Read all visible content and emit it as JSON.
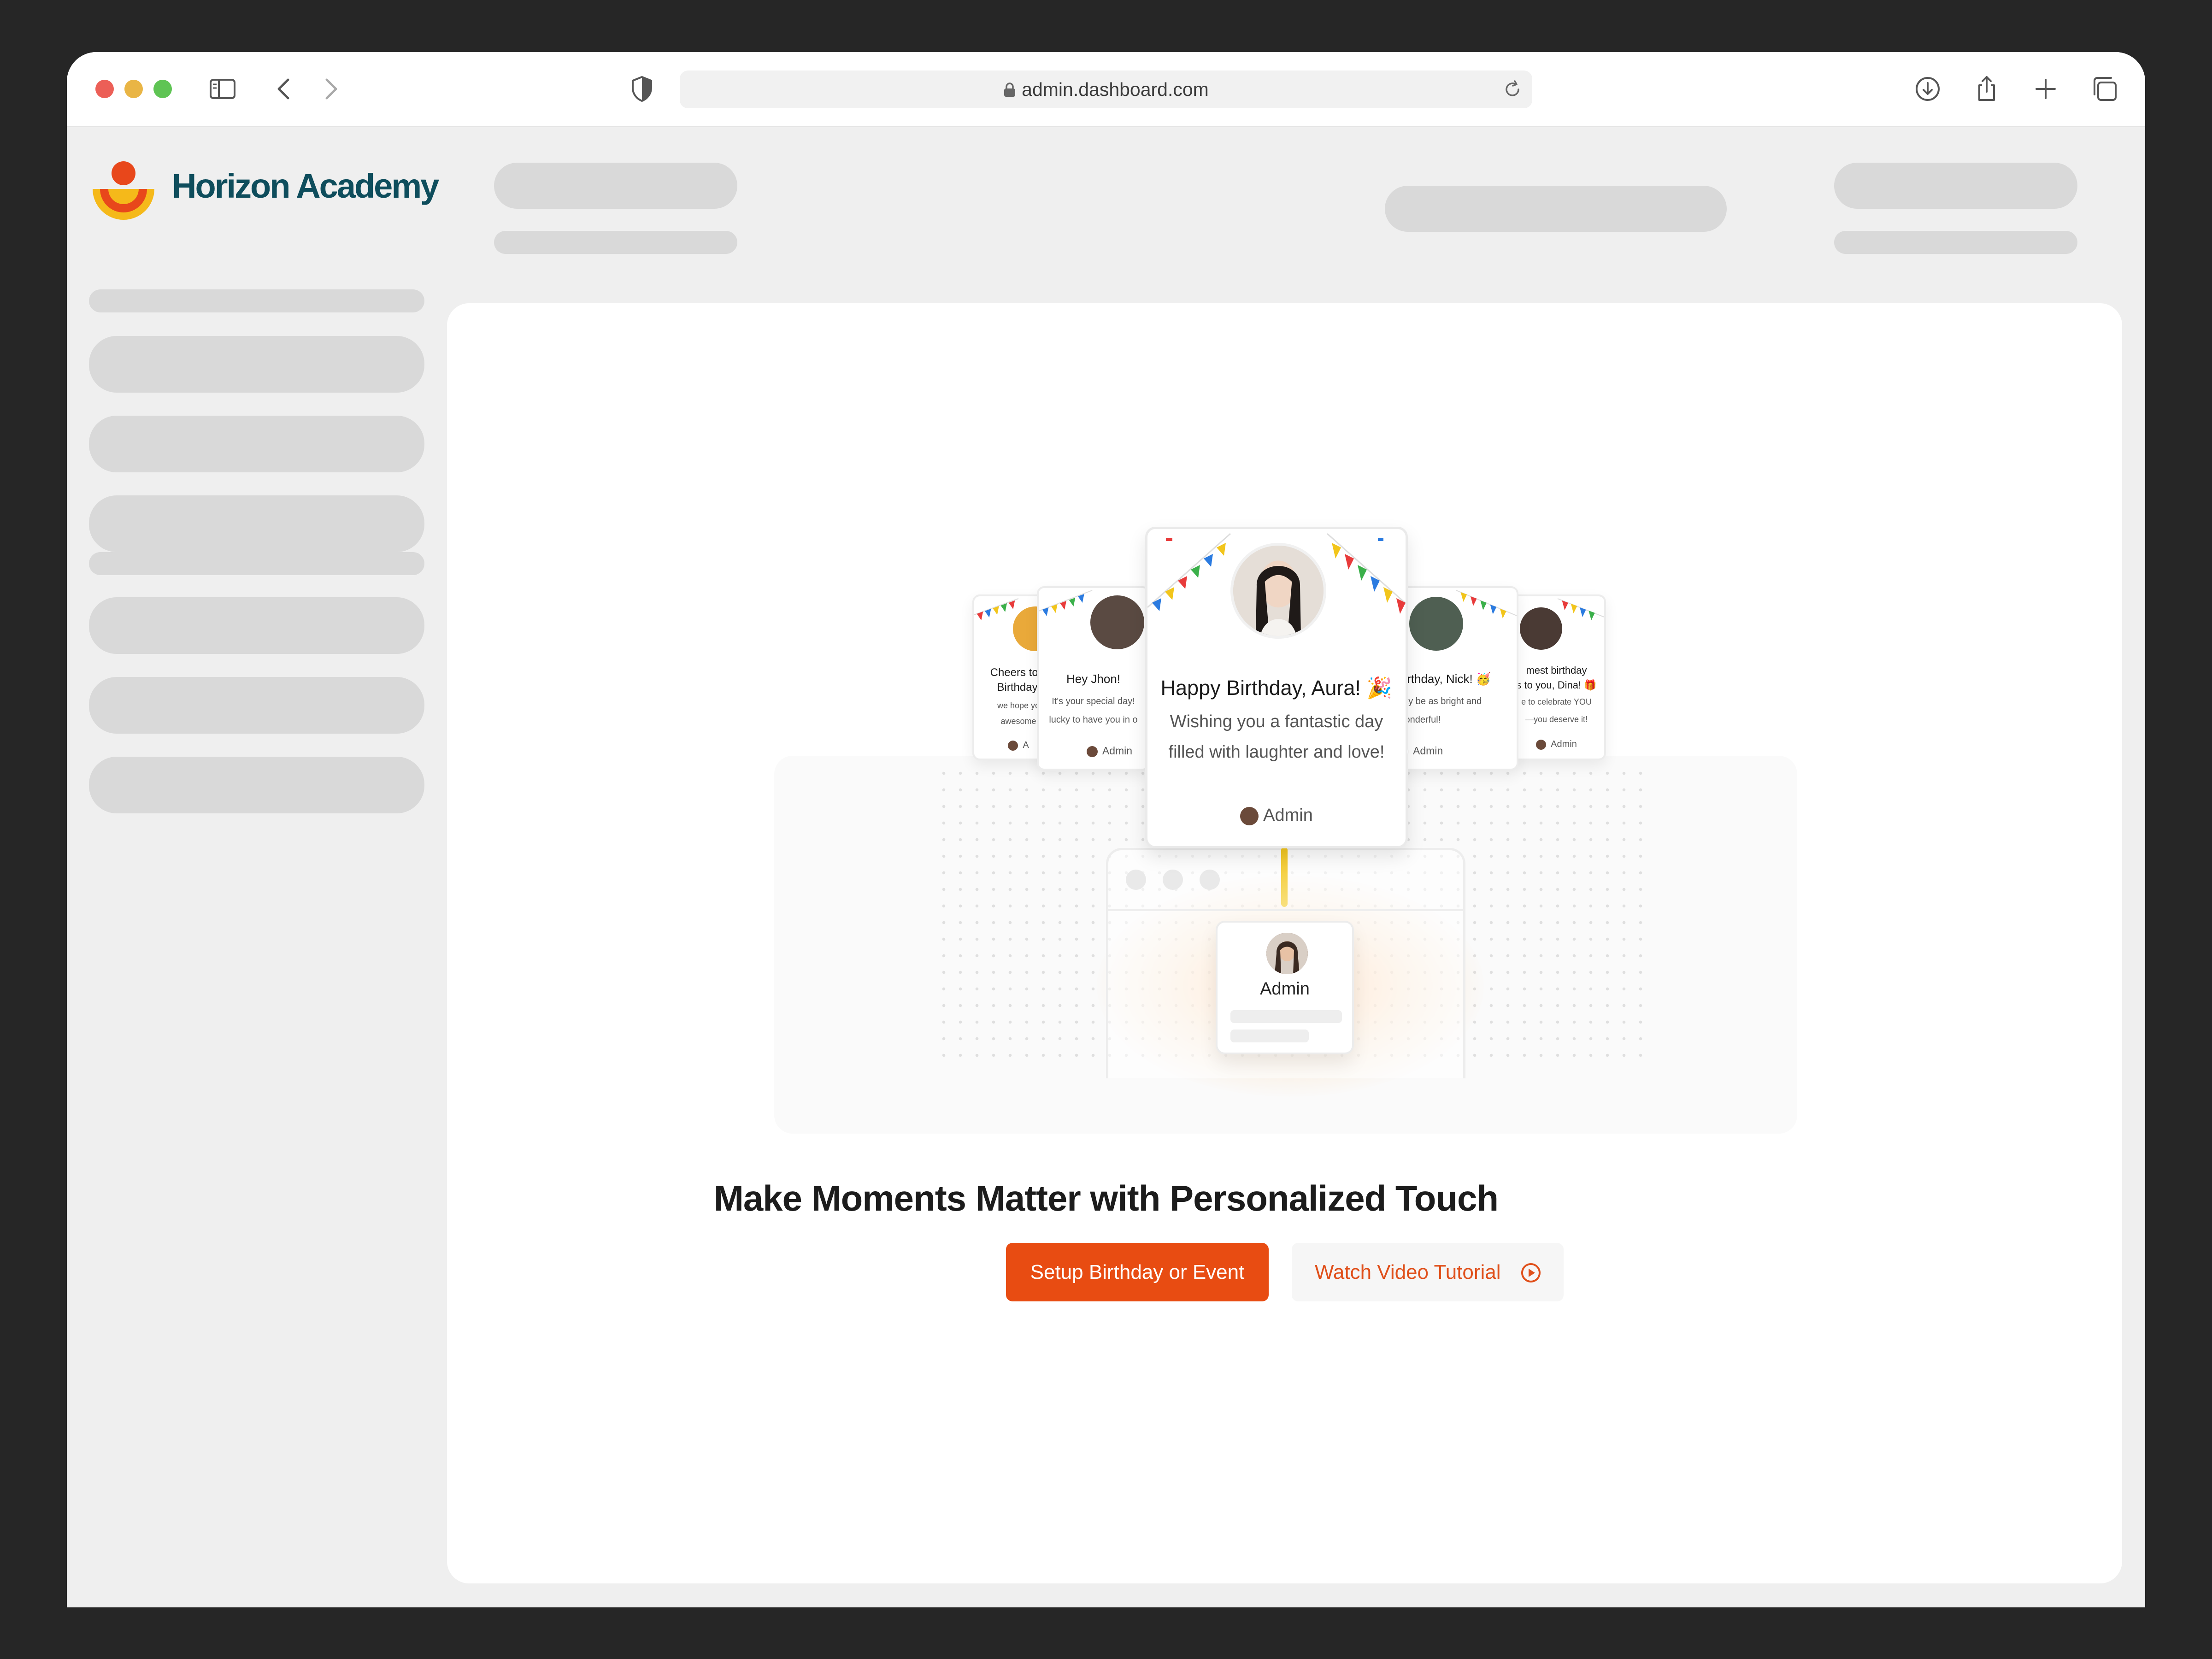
{
  "browser": {
    "url": "admin.dashboard.com",
    "icons": {
      "sidebar": "sidebar-toggle-icon",
      "back": "chevron-left-icon",
      "forward": "chevron-right-icon",
      "shield": "shield-icon",
      "lock": "lock-icon",
      "reload": "reload-icon",
      "download": "download-icon",
      "share": "share-icon",
      "new_tab": "plus-icon",
      "tabs": "tabs-overview-icon"
    }
  },
  "app": {
    "brand": "Horizon Academy",
    "logo_icon": "horizon-academy-logo"
  },
  "hero": {
    "headline": "Make Moments Matter with Personalized Touch",
    "primary_button": "Setup Birthday or Event",
    "secondary_button": "Watch Video Tutorial",
    "secondary_icon": "play-circle-icon"
  },
  "illustration": {
    "main_card": {
      "title": "Happy Birthday, Aura! 🎉",
      "message": "Wishing you a fantastic day filled with laughter and love!",
      "from": "Admin"
    },
    "left_far_card": {
      "title_line1": "Cheers to y",
      "title_line2": "Birthday,",
      "line1": "we hope yo",
      "line2": "awesome",
      "from": "A"
    },
    "left_card": {
      "title": "Hey Jhon!",
      "line1": "It's your special day!",
      "line2": "lucky to have you in o",
      "from": "Admin"
    },
    "right_card": {
      "title": "Birthday, Nick! 🥳",
      "line1": "day be as bright and",
      "line2": "wonderful!",
      "from": "Admin"
    },
    "right_far_card": {
      "title_line1": "mest birthday",
      "title_line2": "s to you, Dina! 🎁",
      "line1": "e to celebrate YOU",
      "line2": "—you deserve it!",
      "from": "Admin"
    },
    "sender_card": {
      "name": "Admin"
    }
  },
  "colors": {
    "accent": "#e84c12",
    "brand_text": "#0e4d5c",
    "logo_orange": "#e8471b",
    "logo_yellow": "#f5b91a"
  }
}
